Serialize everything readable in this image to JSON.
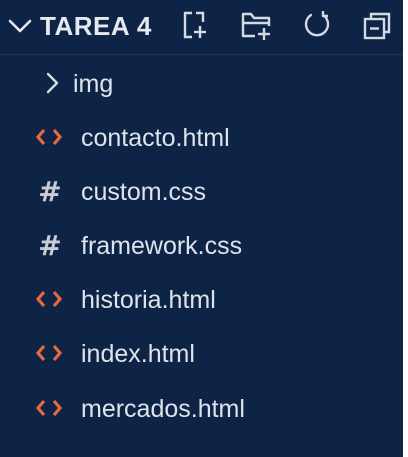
{
  "explorer": {
    "title": "TAREA 4",
    "header_icons": [
      "new-file-icon",
      "new-folder-icon",
      "refresh-icon",
      "collapse-all-icon"
    ],
    "colors": {
      "background": "#0d2447",
      "html_icon": "#e46a3a",
      "css_icon": "#c9ccd3",
      "text": "#dfe3ea"
    },
    "items": [
      {
        "type": "folder",
        "label": "img",
        "icon": "chevron-right-icon"
      },
      {
        "type": "file",
        "label": "contacto.html",
        "icon": "html-file-icon"
      },
      {
        "type": "file",
        "label": "custom.css",
        "icon": "css-file-icon"
      },
      {
        "type": "file",
        "label": "framework.css",
        "icon": "css-file-icon"
      },
      {
        "type": "file",
        "label": "historia.html",
        "icon": "html-file-icon"
      },
      {
        "type": "file",
        "label": "index.html",
        "icon": "html-file-icon"
      },
      {
        "type": "file",
        "label": "mercados.html",
        "icon": "html-file-icon"
      }
    ]
  }
}
